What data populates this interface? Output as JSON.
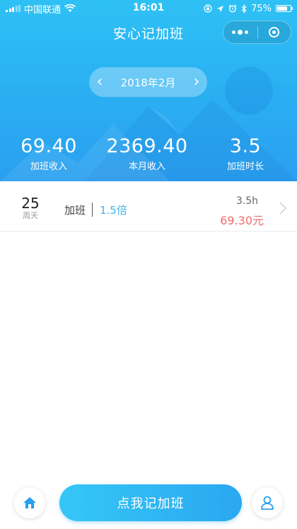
{
  "status_bar": {
    "carrier": "中国联通",
    "time": "16:01",
    "battery": "75%",
    "battery_level": 0.75,
    "icons": [
      "signal-icon",
      "wifi-icon",
      "rotation-lock-icon",
      "location-icon",
      "alarm-icon",
      "bluetooth-icon",
      "battery-icon"
    ]
  },
  "header": {
    "title": "安心记加班",
    "capsule_icons": [
      "more-icon",
      "close-icon"
    ]
  },
  "month_selector": {
    "label": "2018年2月",
    "prev_icon": "chevron-left-icon",
    "next_icon": "chevron-right-icon",
    "prev_glyph": "‹",
    "next_glyph": "›"
  },
  "stats": [
    {
      "value": "69.40",
      "label": "加班收入"
    },
    {
      "value": "2369.40",
      "label": "本月收入"
    },
    {
      "value": "3.5",
      "label": "加班时长"
    }
  ],
  "records": [
    {
      "day": "25",
      "weekday": "周天",
      "type": "加班",
      "rate": "1.5倍",
      "hours": "3.5h",
      "amount": "69.30元"
    }
  ],
  "bottom_bar": {
    "add_label": "点我记加班",
    "home_icon": "home-icon",
    "user_icon": "user-icon"
  },
  "colors": {
    "brand_blue": "#2aaef2",
    "rate_blue": "#40b5ea",
    "amount_red": "#f06c6c"
  }
}
